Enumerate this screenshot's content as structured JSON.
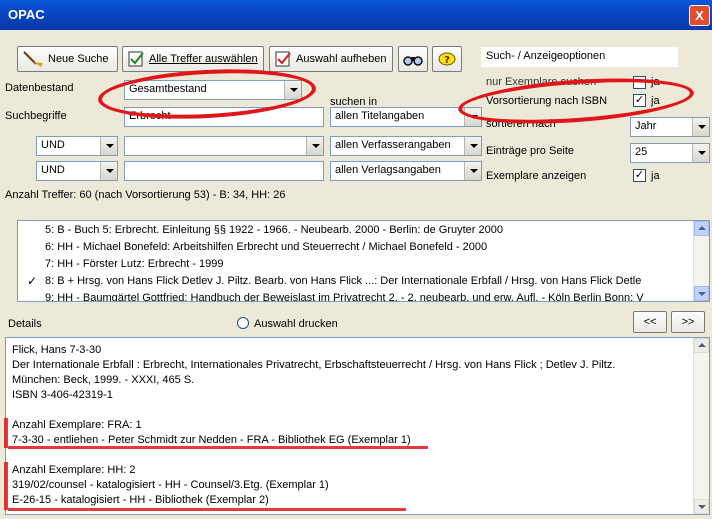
{
  "window": {
    "title": "OPAC",
    "close_glyph": "X"
  },
  "toolbar": {
    "new_search": "Neue Suche",
    "select_all": "Alle Treffer auswählen",
    "clear_selection": "Auswahl aufheben"
  },
  "options": {
    "header": "Such- / Anzeigeoptionen",
    "only_copies_label": "nur Exemplare suchen",
    "only_copies_value": "ja",
    "presort_label": "Vorsortierung nach ISBN",
    "presort_value": "ja",
    "presort_checked": true,
    "sort_label": "sortieren nach",
    "sort_value": "Jahr",
    "per_page_label": "Einträge pro Seite",
    "per_page_value": "25",
    "show_copies_label": "Exemplare anzeigen",
    "show_copies_value": "ja",
    "show_copies_checked": true
  },
  "search": {
    "datenbestand_label": "Datenbestand",
    "datenbestand_value": "Gesamtbestand",
    "suchbegriffe_label": "Suchbegriffe",
    "term1": "Erbrecht",
    "suchen_in_label": "suchen in",
    "field1": "allen Titelangaben",
    "op2": "UND",
    "term2": "",
    "field2": "allen Verfasserangaben",
    "op3": "UND",
    "term3": "",
    "field3": "allen Verlagsangaben"
  },
  "hits_summary": "Anzahl Treffer: 60 (nach Vorsortierung 53) - B: 34, HH: 26",
  "results": [
    {
      "text": "5: B - Buch 5: Erbrecht. Einleitung §§ 1922 - 1966. - Neubearb. 2000 - Berlin: de Gruyter 2000",
      "checked": false
    },
    {
      "text": "6: HH - Michael Bonefeld: Arbeitshilfen Erbrecht und Steuerrecht / Michael Bonefeld - 2000",
      "checked": false
    },
    {
      "text": "7: HH - Förster Lutz: Erbrecht - 1999",
      "checked": false
    },
    {
      "text": "8: B + Hrsg. von Hans Flick  Detlev J. Piltz. Bearb. von Hans Flick ...: Der Internationale Erbfall / Hrsg. von Hans Flick  Detle",
      "checked": true
    },
    {
      "text": "9: HH - Baumgärtel Gottfried: Handbuch der Beweislast im Privatrecht 2. - 2. neubearb. und erw. Aufl. - Köln Berlin Bonn: V",
      "checked": false
    }
  ],
  "details_bar": {
    "label": "Details",
    "print_label": "Auswahl drucken",
    "prev": "<<",
    "next": ">>"
  },
  "details": [
    "Flick, Hans                7-3-30",
    "Der Internationale Erbfall : Erbrecht, Internationales Privatrecht, Erbschaftsteuerrecht / Hrsg. von Hans Flick ; Detlev J. Piltz.",
    "München: Beck, 1999. - XXXI, 465 S.",
    "ISBN 3-406-42319-1",
    "",
    "Anzahl Exemplare:  FRA: 1",
    "7-3-30 - entliehen - Peter Schmidt zur Nedden - FRA - Bibliothek EG (Exemplar 1)",
    "",
    "Anzahl Exemplare:  HH: 2",
    "319/02/counsel - katalogisiert - HH - Counsel/3.Etg. (Exemplar 1)",
    "E-26-15 - katalogisiert - HH - Bibliothek (Exemplar 2)"
  ],
  "colors": {
    "annotation_red": "#e0161a",
    "titlebar_blue": "#0a58d8"
  },
  "icons": [
    "broom-icon",
    "select-all-icon",
    "deselect-icon",
    "binoculars-icon",
    "help-icon"
  ]
}
